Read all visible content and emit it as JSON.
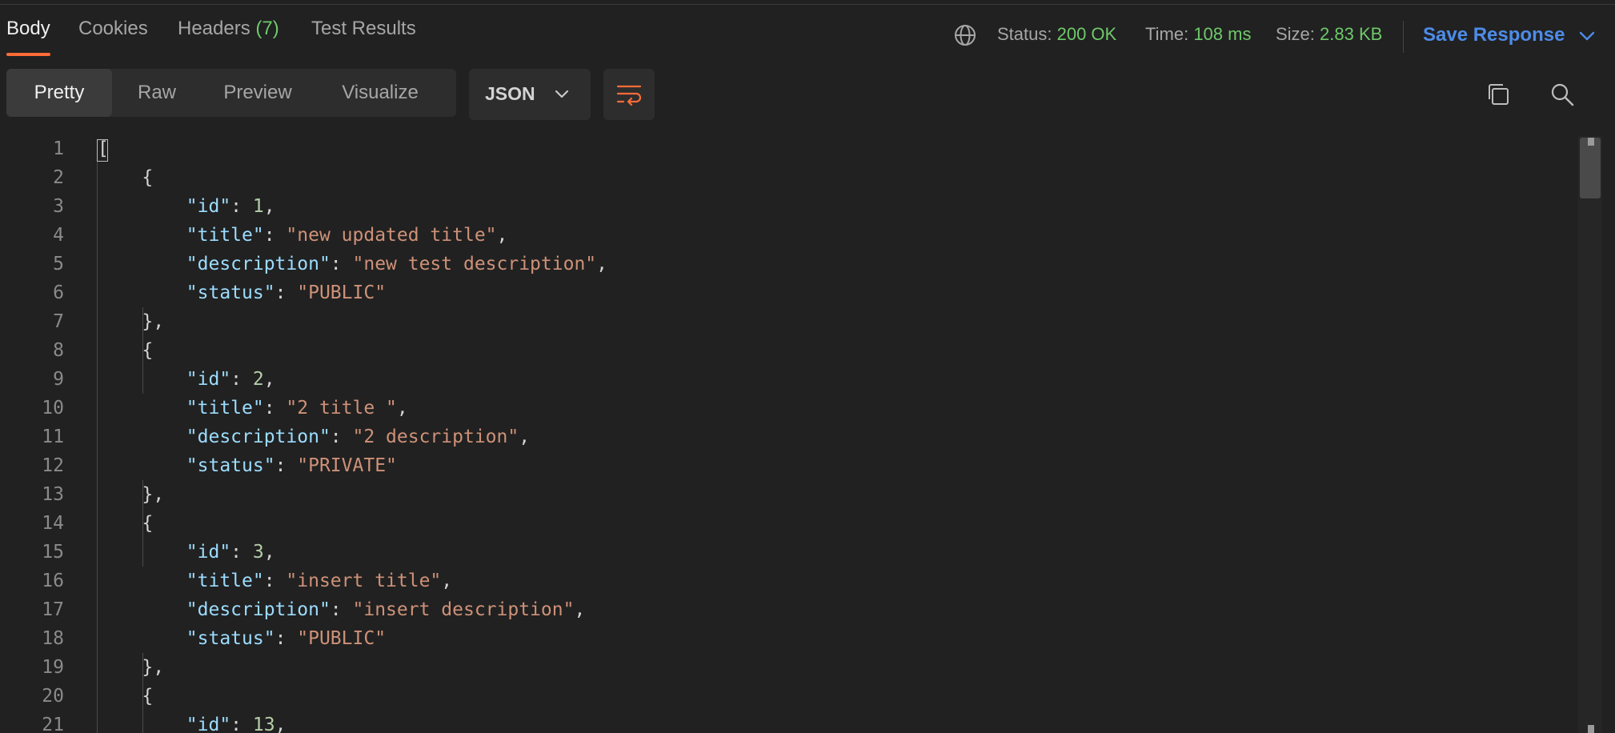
{
  "tabs": [
    {
      "label": "Body",
      "active": true
    },
    {
      "label": "Cookies"
    },
    {
      "label": "Headers",
      "count": "(7)"
    },
    {
      "label": "Test Results"
    }
  ],
  "response_meta": {
    "status_label": "Status:",
    "status_value": "200 OK",
    "time_label": "Time:",
    "time_value": "108 ms",
    "size_label": "Size:",
    "size_value": "2.83 KB"
  },
  "save_response": {
    "label": "Save Response",
    "icon": "chevron-down-icon"
  },
  "view_modes": [
    {
      "label": "Pretty",
      "active": true
    },
    {
      "label": "Raw"
    },
    {
      "label": "Preview"
    },
    {
      "label": "Visualize"
    }
  ],
  "format_select": {
    "value": "JSON"
  },
  "icons": [
    "globe-icon",
    "wrap-lines-icon",
    "copy-icon",
    "search-icon"
  ],
  "colors": {
    "accent": "#ff6c37",
    "link": "#4d8ce8",
    "success": "#6ec96a",
    "json_key": "#9cdcfe",
    "json_string": "#ce9178",
    "json_number": "#b5cea8"
  },
  "code_lines": [
    {
      "n": "1",
      "t": [
        [
          "p",
          "["
        ]
      ]
    },
    {
      "n": "2",
      "t": [
        [
          "p",
          "    {"
        ]
      ]
    },
    {
      "n": "3",
      "t": [
        [
          "p",
          "        "
        ],
        [
          "k",
          "\"id\""
        ],
        [
          "p",
          ": "
        ],
        [
          "n",
          "1"
        ],
        [
          "p",
          ","
        ]
      ]
    },
    {
      "n": "4",
      "t": [
        [
          "p",
          "        "
        ],
        [
          "k",
          "\"title\""
        ],
        [
          "p",
          ": "
        ],
        [
          "s",
          "\"new updated title\""
        ],
        [
          "p",
          ","
        ]
      ]
    },
    {
      "n": "5",
      "t": [
        [
          "p",
          "        "
        ],
        [
          "k",
          "\"description\""
        ],
        [
          "p",
          ": "
        ],
        [
          "s",
          "\"new test description\""
        ],
        [
          "p",
          ","
        ]
      ]
    },
    {
      "n": "6",
      "t": [
        [
          "p",
          "        "
        ],
        [
          "k",
          "\"status\""
        ],
        [
          "p",
          ": "
        ],
        [
          "s",
          "\"PUBLIC\""
        ]
      ]
    },
    {
      "n": "7",
      "t": [
        [
          "p",
          "    },"
        ]
      ]
    },
    {
      "n": "8",
      "t": [
        [
          "p",
          "    {"
        ]
      ]
    },
    {
      "n": "9",
      "t": [
        [
          "p",
          "        "
        ],
        [
          "k",
          "\"id\""
        ],
        [
          "p",
          ": "
        ],
        [
          "n",
          "2"
        ],
        [
          "p",
          ","
        ]
      ]
    },
    {
      "n": "10",
      "t": [
        [
          "p",
          "        "
        ],
        [
          "k",
          "\"title\""
        ],
        [
          "p",
          ": "
        ],
        [
          "s",
          "\"2 title \""
        ],
        [
          "p",
          ","
        ]
      ]
    },
    {
      "n": "11",
      "t": [
        [
          "p",
          "        "
        ],
        [
          "k",
          "\"description\""
        ],
        [
          "p",
          ": "
        ],
        [
          "s",
          "\"2 description\""
        ],
        [
          "p",
          ","
        ]
      ]
    },
    {
      "n": "12",
      "t": [
        [
          "p",
          "        "
        ],
        [
          "k",
          "\"status\""
        ],
        [
          "p",
          ": "
        ],
        [
          "s",
          "\"PRIVATE\""
        ]
      ]
    },
    {
      "n": "13",
      "t": [
        [
          "p",
          "    },"
        ]
      ]
    },
    {
      "n": "14",
      "t": [
        [
          "p",
          "    {"
        ]
      ]
    },
    {
      "n": "15",
      "t": [
        [
          "p",
          "        "
        ],
        [
          "k",
          "\"id\""
        ],
        [
          "p",
          ": "
        ],
        [
          "n",
          "3"
        ],
        [
          "p",
          ","
        ]
      ]
    },
    {
      "n": "16",
      "t": [
        [
          "p",
          "        "
        ],
        [
          "k",
          "\"title\""
        ],
        [
          "p",
          ": "
        ],
        [
          "s",
          "\"insert title\""
        ],
        [
          "p",
          ","
        ]
      ]
    },
    {
      "n": "17",
      "t": [
        [
          "p",
          "        "
        ],
        [
          "k",
          "\"description\""
        ],
        [
          "p",
          ": "
        ],
        [
          "s",
          "\"insert description\""
        ],
        [
          "p",
          ","
        ]
      ]
    },
    {
      "n": "18",
      "t": [
        [
          "p",
          "        "
        ],
        [
          "k",
          "\"status\""
        ],
        [
          "p",
          ": "
        ],
        [
          "s",
          "\"PUBLIC\""
        ]
      ]
    },
    {
      "n": "19",
      "t": [
        [
          "p",
          "    },"
        ]
      ]
    },
    {
      "n": "20",
      "t": [
        [
          "p",
          "    {"
        ]
      ]
    },
    {
      "n": "21",
      "t": [
        [
          "p",
          "        "
        ],
        [
          "k",
          "\"id\""
        ],
        [
          "p",
          ": "
        ],
        [
          "n",
          "13"
        ],
        [
          "p",
          ","
        ]
      ]
    }
  ]
}
